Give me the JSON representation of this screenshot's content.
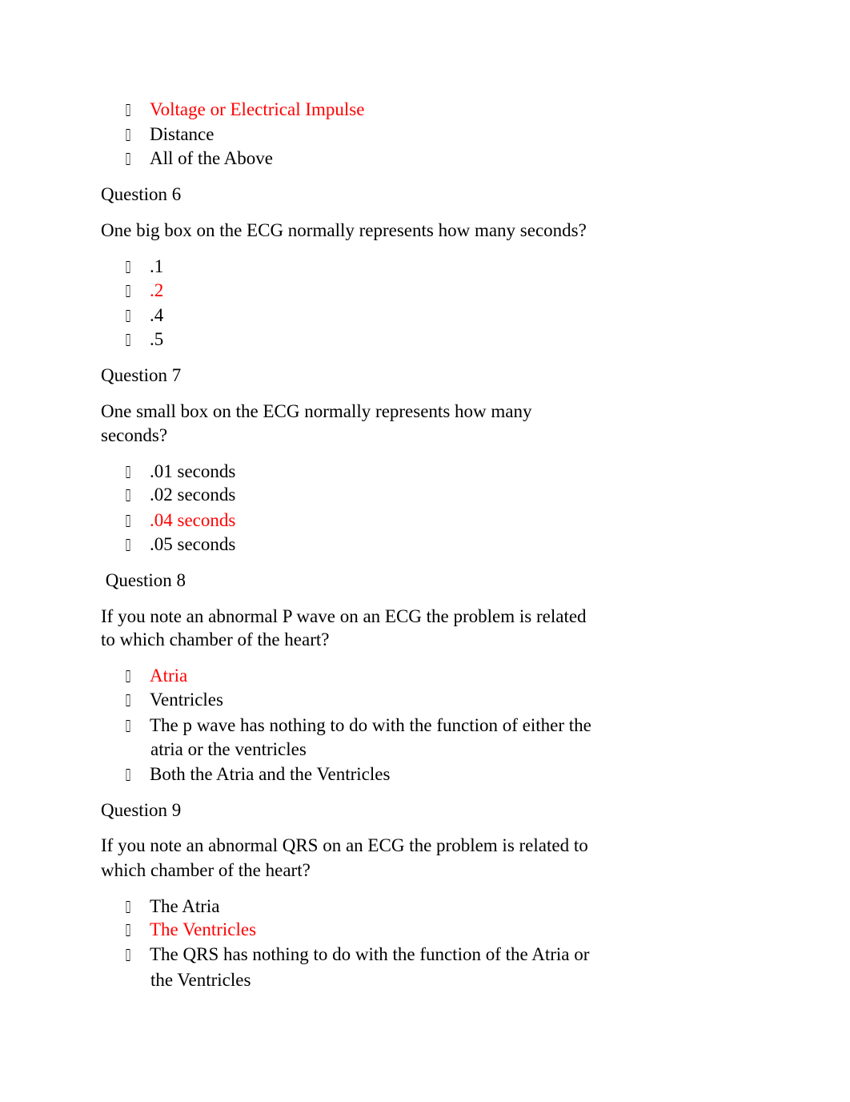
{
  "document": {
    "prev_options": [
      {
        "text": "Voltage or Electrical Impulse",
        "correct": true
      },
      {
        "text": "Distance",
        "correct": false
      },
      {
        "text": "All of the Above",
        "correct": false
      }
    ],
    "questions": [
      {
        "heading": "Question 6",
        "prompt": [
          "One big box on the ECG normally represents how many seconds?"
        ],
        "options": [
          {
            "text": ".1",
            "correct": false
          },
          {
            "text": ".2",
            "correct": true
          },
          {
            "text": ".4",
            "correct": false
          },
          {
            "text": ".5",
            "correct": false
          }
        ]
      },
      {
        "heading": "Question 7",
        "prompt": [
          "One small box on the ECG normally represents how many",
          "seconds?"
        ],
        "options": [
          {
            "text": ".01 seconds",
            "correct": false
          },
          {
            "text": ".02 seconds",
            "correct": false
          },
          {
            "text": ".04 seconds",
            "correct": true
          },
          {
            "text": ".05 seconds",
            "correct": false
          }
        ]
      },
      {
        "heading": " Question 8",
        "prompt": [
          "If you note an abnormal P wave on an ECG the problem is related",
          "to which chamber of the heart?"
        ],
        "options": [
          {
            "text": "Atria",
            "correct": true
          },
          {
            "text": "Ventricles",
            "correct": false
          },
          {
            "text": [
              "The p wave has nothing to do with the function of either the",
              "atria or the ventricles"
            ],
            "correct": false
          },
          {
            "text": "Both the Atria and the Ventricles",
            "correct": false
          }
        ]
      },
      {
        "heading": "Question 9",
        "prompt": [
          "If you note an abnormal QRS on an ECG the problem is related to",
          "which chamber of the heart?"
        ],
        "options": [
          {
            "text": "The Atria",
            "correct": false
          },
          {
            "text": "The Ventricles",
            "correct": true
          },
          {
            "text": [
              "The QRS has nothing to do with the function of the Atria or",
              "the Ventricles"
            ],
            "correct": false
          }
        ]
      }
    ],
    "colors": {
      "correct_answer": "#ff0000",
      "text": "#000000"
    }
  }
}
